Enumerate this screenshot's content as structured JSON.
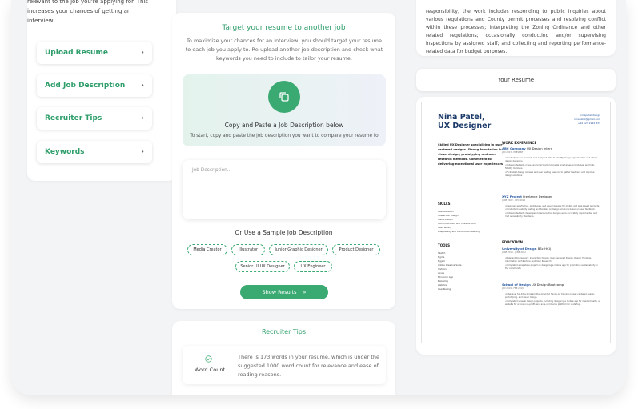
{
  "left": {
    "intro": "relevant to the job you're applying for. This increases your chances of getting an interview.",
    "menu": [
      {
        "label": "Upload Resume"
      },
      {
        "label": "Add Job Description"
      },
      {
        "label": "Recruiter Tips"
      },
      {
        "label": "Keywords"
      }
    ]
  },
  "target": {
    "title": "Target your resume to another job",
    "description": "To maximize your chances for an interview, you should target your resume to each job you apply to. Re-upload another job description and check what keywords you need to include to tailor your resume.",
    "paste_title": "Copy and Paste a Job Description below",
    "paste_sub": "To start, copy and paste the job description you want to compare your resume to",
    "input_placeholder": "Job Description...",
    "sample_title": "Or Use a Sample Job Description",
    "samples": [
      "Media Creator",
      "Illustrator",
      "Junior Graphic Designer",
      "Product Designer",
      "Senior UI UX Designer",
      "UX Engineer"
    ],
    "show_results": "Show Results",
    "show_results_icon": "»"
  },
  "tips": {
    "title": "Recruiter Tips",
    "word_count_label": "Word Count",
    "word_count_text": "There is 173 words in your resume, which is under the suggested 1000 word count for relevance and ease of reading reasons.",
    "check_icon": "check-circle-icon"
  },
  "right": {
    "job_text": "responsibility, the work includes responding to public inquiries about various regulations and County permit processes and resolving conflict within these processes; interpreting the Zoning Ordinance and other related regulations; occasionally conducting and/or supervising inspections by assigned staff; and collecting and reporting performance-related data for budget purposes.",
    "your_resume": "Your Resume"
  },
  "resume": {
    "name_line1": "Nina Patel,",
    "name_line2": "UX Designer",
    "contact": [
      "ninapatel.design",
      "ninapatel@gmail.com",
      "+44 123 2222 333"
    ],
    "summary": "Skilled UX Designer specializing in user-centered designs. Strong foundation in visual design, prototyping and user research methods. Committed to delivering exceptional user experiences",
    "skills_title": "SKILLS",
    "skills": [
      "User Research",
      "Interaction Design",
      "Visual Design",
      "Communication and Collaboration",
      "User Testing",
      "Adaptability and Continuous Learning"
    ],
    "tools_title": "TOOLS",
    "tools": [
      "Sketch",
      "Figma",
      "Figjam",
      "Adobe Creative Suite",
      "InVision",
      "Axure",
      "Miro.com App",
      "Balsamiq",
      "Webflow",
      "UserTesting"
    ],
    "work_title": "WORK EXPERIENCE",
    "jobs": [
      {
        "org": "ABC Company",
        "role": "UX Design Intern",
        "date": "JAN 2023 - PRESENT",
        "bullets": [
          "Conducted user research and analyzed data to identify design opportunities and inform design decisions.",
          "Collaborated with cross-functional teams to create wireframes, prototypes, and high-fidelity mockups.",
          "Facilitated design reviews and user testing sessions to gather feedback and improve design solutions."
        ]
      },
      {
        "org": "XYZ Project",
        "role": "Freelance Designer",
        "date": "JUNE 2022 - DEC 2022",
        "bullets": [
          "Designed wireframes, prototypes, and visual designs for mobile and web-based products.",
          "Conducted usability testing and iterated on design solutions based on user feedback.",
          "Collaborated with developers to ensure that designs were accurately implemented and met accessibility standards."
        ]
      }
    ],
    "education_title": "EDUCATION",
    "education": [
      {
        "org": "University of Design",
        "role": "BSc(HCI)",
        "date": "JUNE 2019 - JUNE 2022",
        "bullets": [
          "Relevant Coursework: Interaction Design, User-Centered Design, Design Thinking, Information Architecture, and User Research",
          "Completed a capstone project on designing a mobile app for promoting sustainability in the community."
        ]
      },
      {
        "org": "School of Design",
        "role": "UX Design Bootcamp",
        "date": "JAN 2019 - FEB 2019",
        "bullets": [
          "Intensive, full-time program that provided hands-on training in user-centered design, prototyping, and visual design.",
          "Completed several design projects, including designing a mobile app for mental health, a website for a local non-profit, and an e-commerce platform for a startup."
        ]
      }
    ]
  },
  "colors": {
    "accent": "#3aaa72",
    "accent_text": "#2f9e6b",
    "resume_name": "#1c3b6a",
    "link": "#2a5aa0"
  }
}
